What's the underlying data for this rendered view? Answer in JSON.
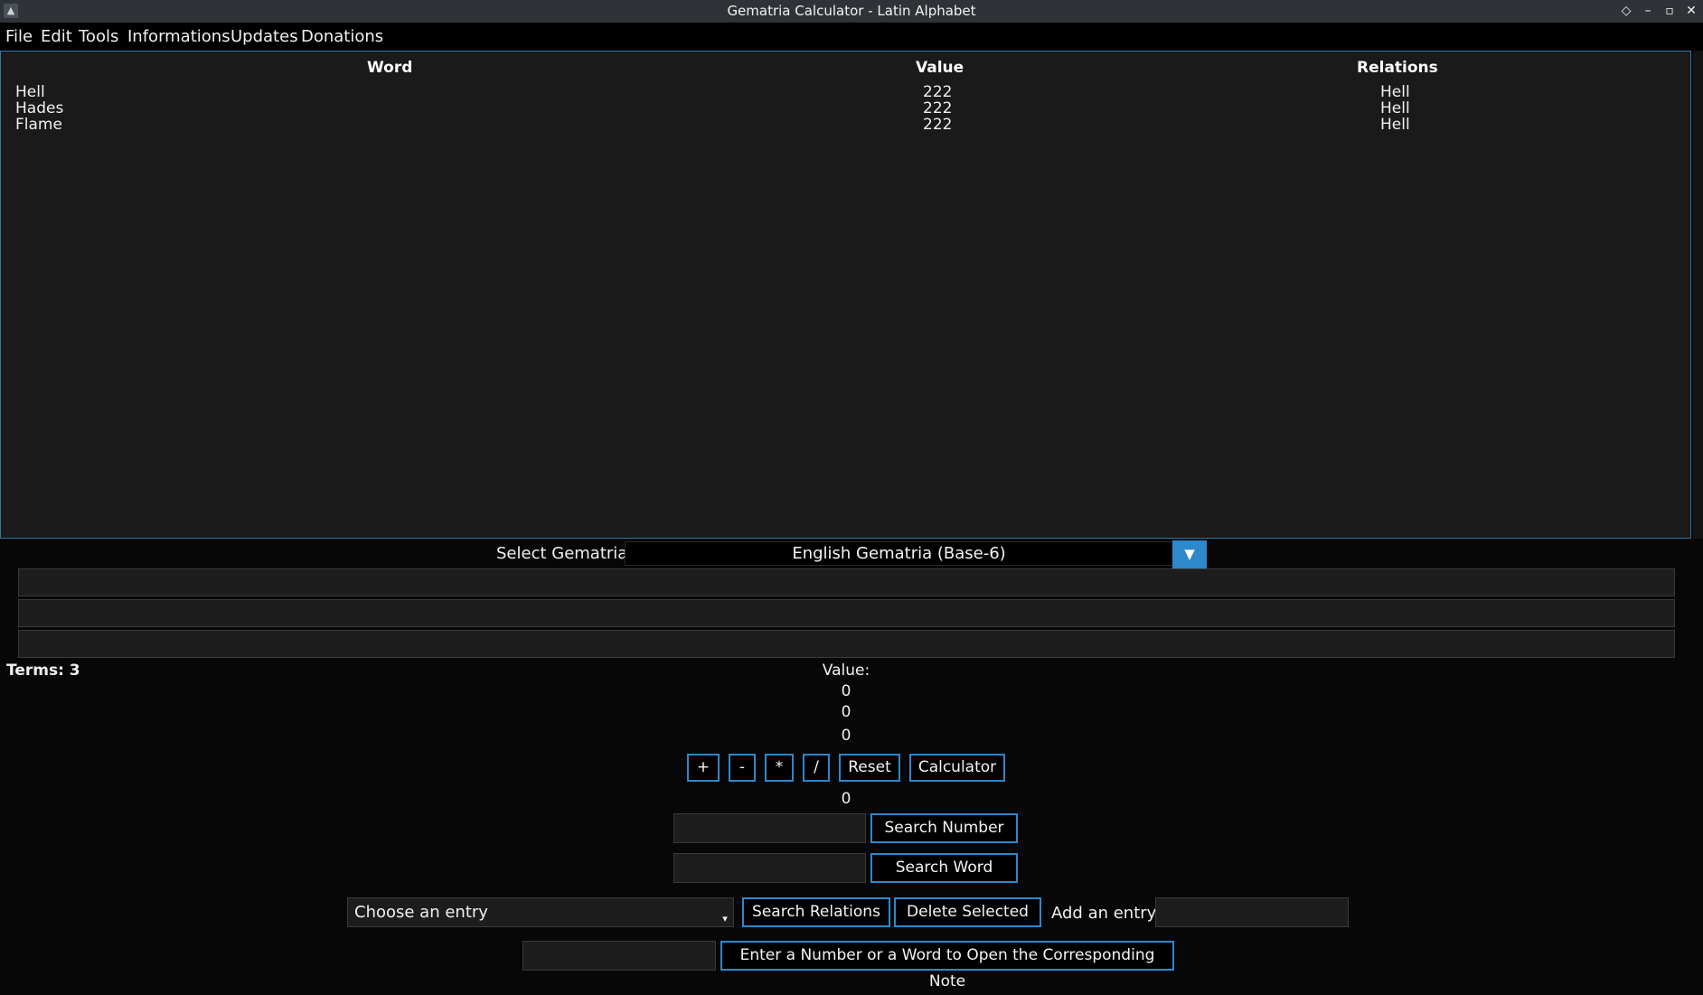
{
  "window": {
    "title": "Gematria Calculator - Latin Alphabet"
  },
  "menu": [
    "File",
    "Edit",
    "Tools",
    "Informations",
    "Updates",
    "Donations"
  ],
  "table": {
    "columns": [
      "Word",
      "Value",
      "Relations"
    ],
    "rows": [
      {
        "word": "Hell",
        "value": "222",
        "relations": "Hell"
      },
      {
        "word": "Hades",
        "value": "222",
        "relations": "Hell"
      },
      {
        "word": "Flame",
        "value": "222",
        "relations": "Hell"
      }
    ]
  },
  "gematria": {
    "label": "Select Gematria:",
    "selected": "English Gematria (Base-6)",
    "arrow": "▼"
  },
  "terms": "Terms: 3",
  "value_label": "Value:",
  "values": [
    "0",
    "0",
    "0"
  ],
  "operations": {
    "plus": "+",
    "minus": "-",
    "multiply": "*",
    "divide": "/",
    "reset": "Reset",
    "calculator": "Calculator"
  },
  "result": "0",
  "search_number_label": "Search Number",
  "search_word_label": "Search Word",
  "choose_entry": "Choose an entry",
  "search_relations_label": "Search Relations",
  "delete_selected_label": "Delete Selected",
  "add_entry_label": "Add an entry:",
  "open_note_label": "Enter a Number or a Word to Open the Corresponding Note",
  "colors": {
    "accent": "#2e88cc",
    "background": "#070707",
    "table_bg": "#1a1a1a"
  }
}
